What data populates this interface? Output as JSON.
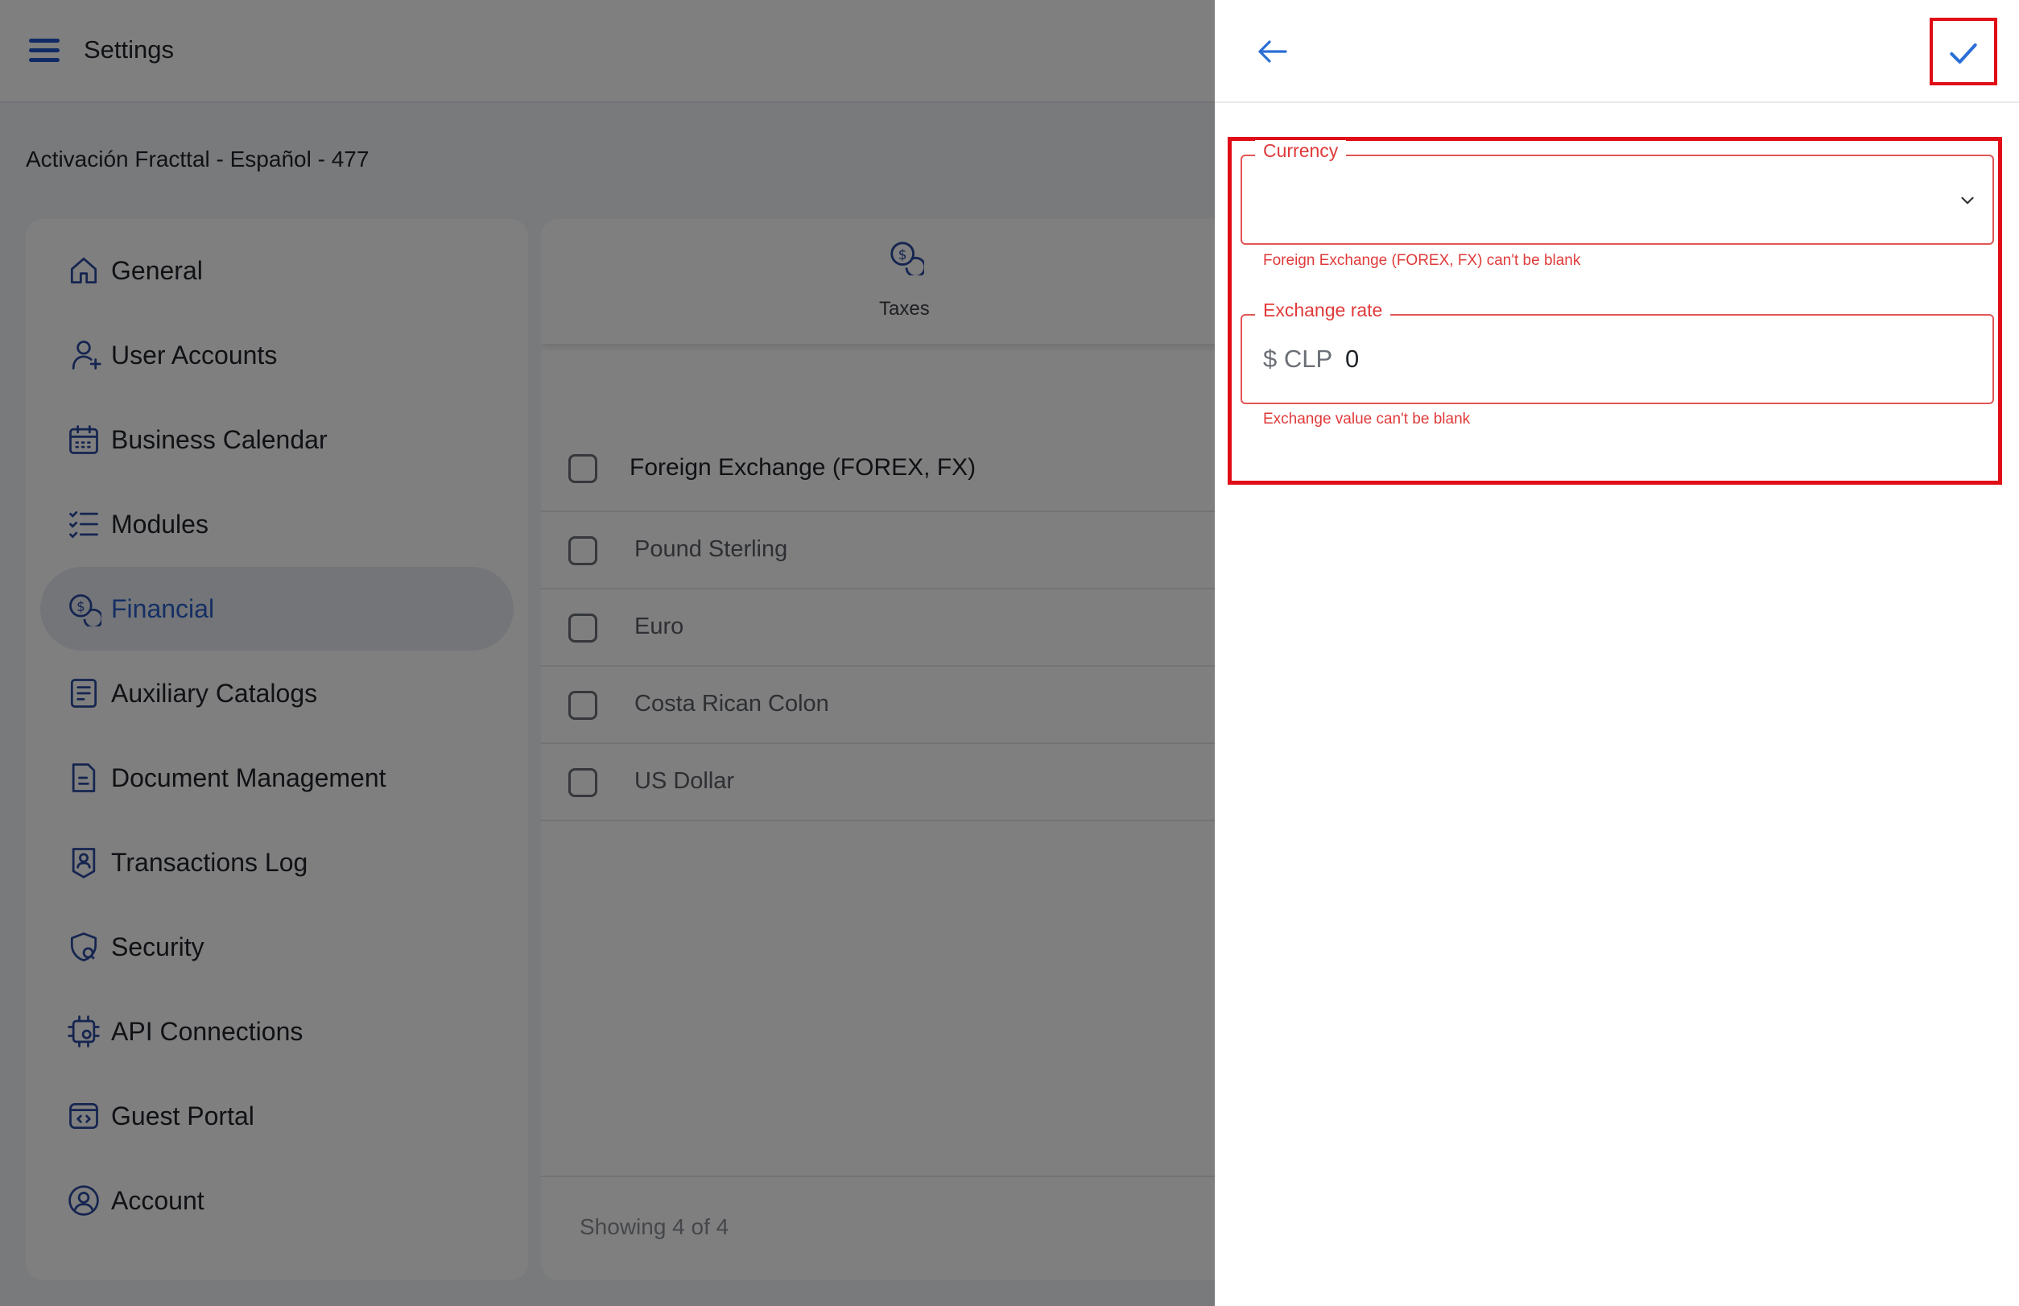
{
  "topbar": {
    "title": "Settings"
  },
  "subheader": {
    "title": "Activación Fracttal - Español - 477"
  },
  "sidebar": {
    "items": [
      {
        "label": "General",
        "icon": "home-icon"
      },
      {
        "label": "User Accounts",
        "icon": "user-add-icon"
      },
      {
        "label": "Business Calendar",
        "icon": "calendar-icon"
      },
      {
        "label": "Modules",
        "icon": "checklist-icon"
      },
      {
        "label": "Financial",
        "icon": "coins-icon",
        "active": true
      },
      {
        "label": "Auxiliary Catalogs",
        "icon": "catalog-icon"
      },
      {
        "label": "Document Management",
        "icon": "document-icon"
      },
      {
        "label": "Transactions Log",
        "icon": "log-badge-icon"
      },
      {
        "label": "Security",
        "icon": "shield-icon"
      },
      {
        "label": "API Connections",
        "icon": "api-gear-icon"
      },
      {
        "label": "Guest Portal",
        "icon": "portal-code-icon"
      },
      {
        "label": "Account",
        "icon": "account-circle-icon"
      }
    ]
  },
  "content": {
    "tab_label": "Taxes",
    "list_header": "Foreign Exchange (FOREX, FX)",
    "rows": [
      "Pound Sterling",
      "Euro",
      "Costa Rican Colon",
      "US Dollar"
    ],
    "footer": "Showing 4 of 4"
  },
  "drawer": {
    "currency": {
      "label": "Currency",
      "value": "",
      "error": "Foreign Exchange (FOREX, FX) can't be blank"
    },
    "exchange_rate": {
      "label": "Exchange rate",
      "prefix": "$ CLP",
      "value": "0",
      "error": "Exchange value can't be blank"
    }
  },
  "colors": {
    "accent": "#2b5fc9",
    "error": "#e03a3a",
    "highlight": "#e00d17"
  }
}
